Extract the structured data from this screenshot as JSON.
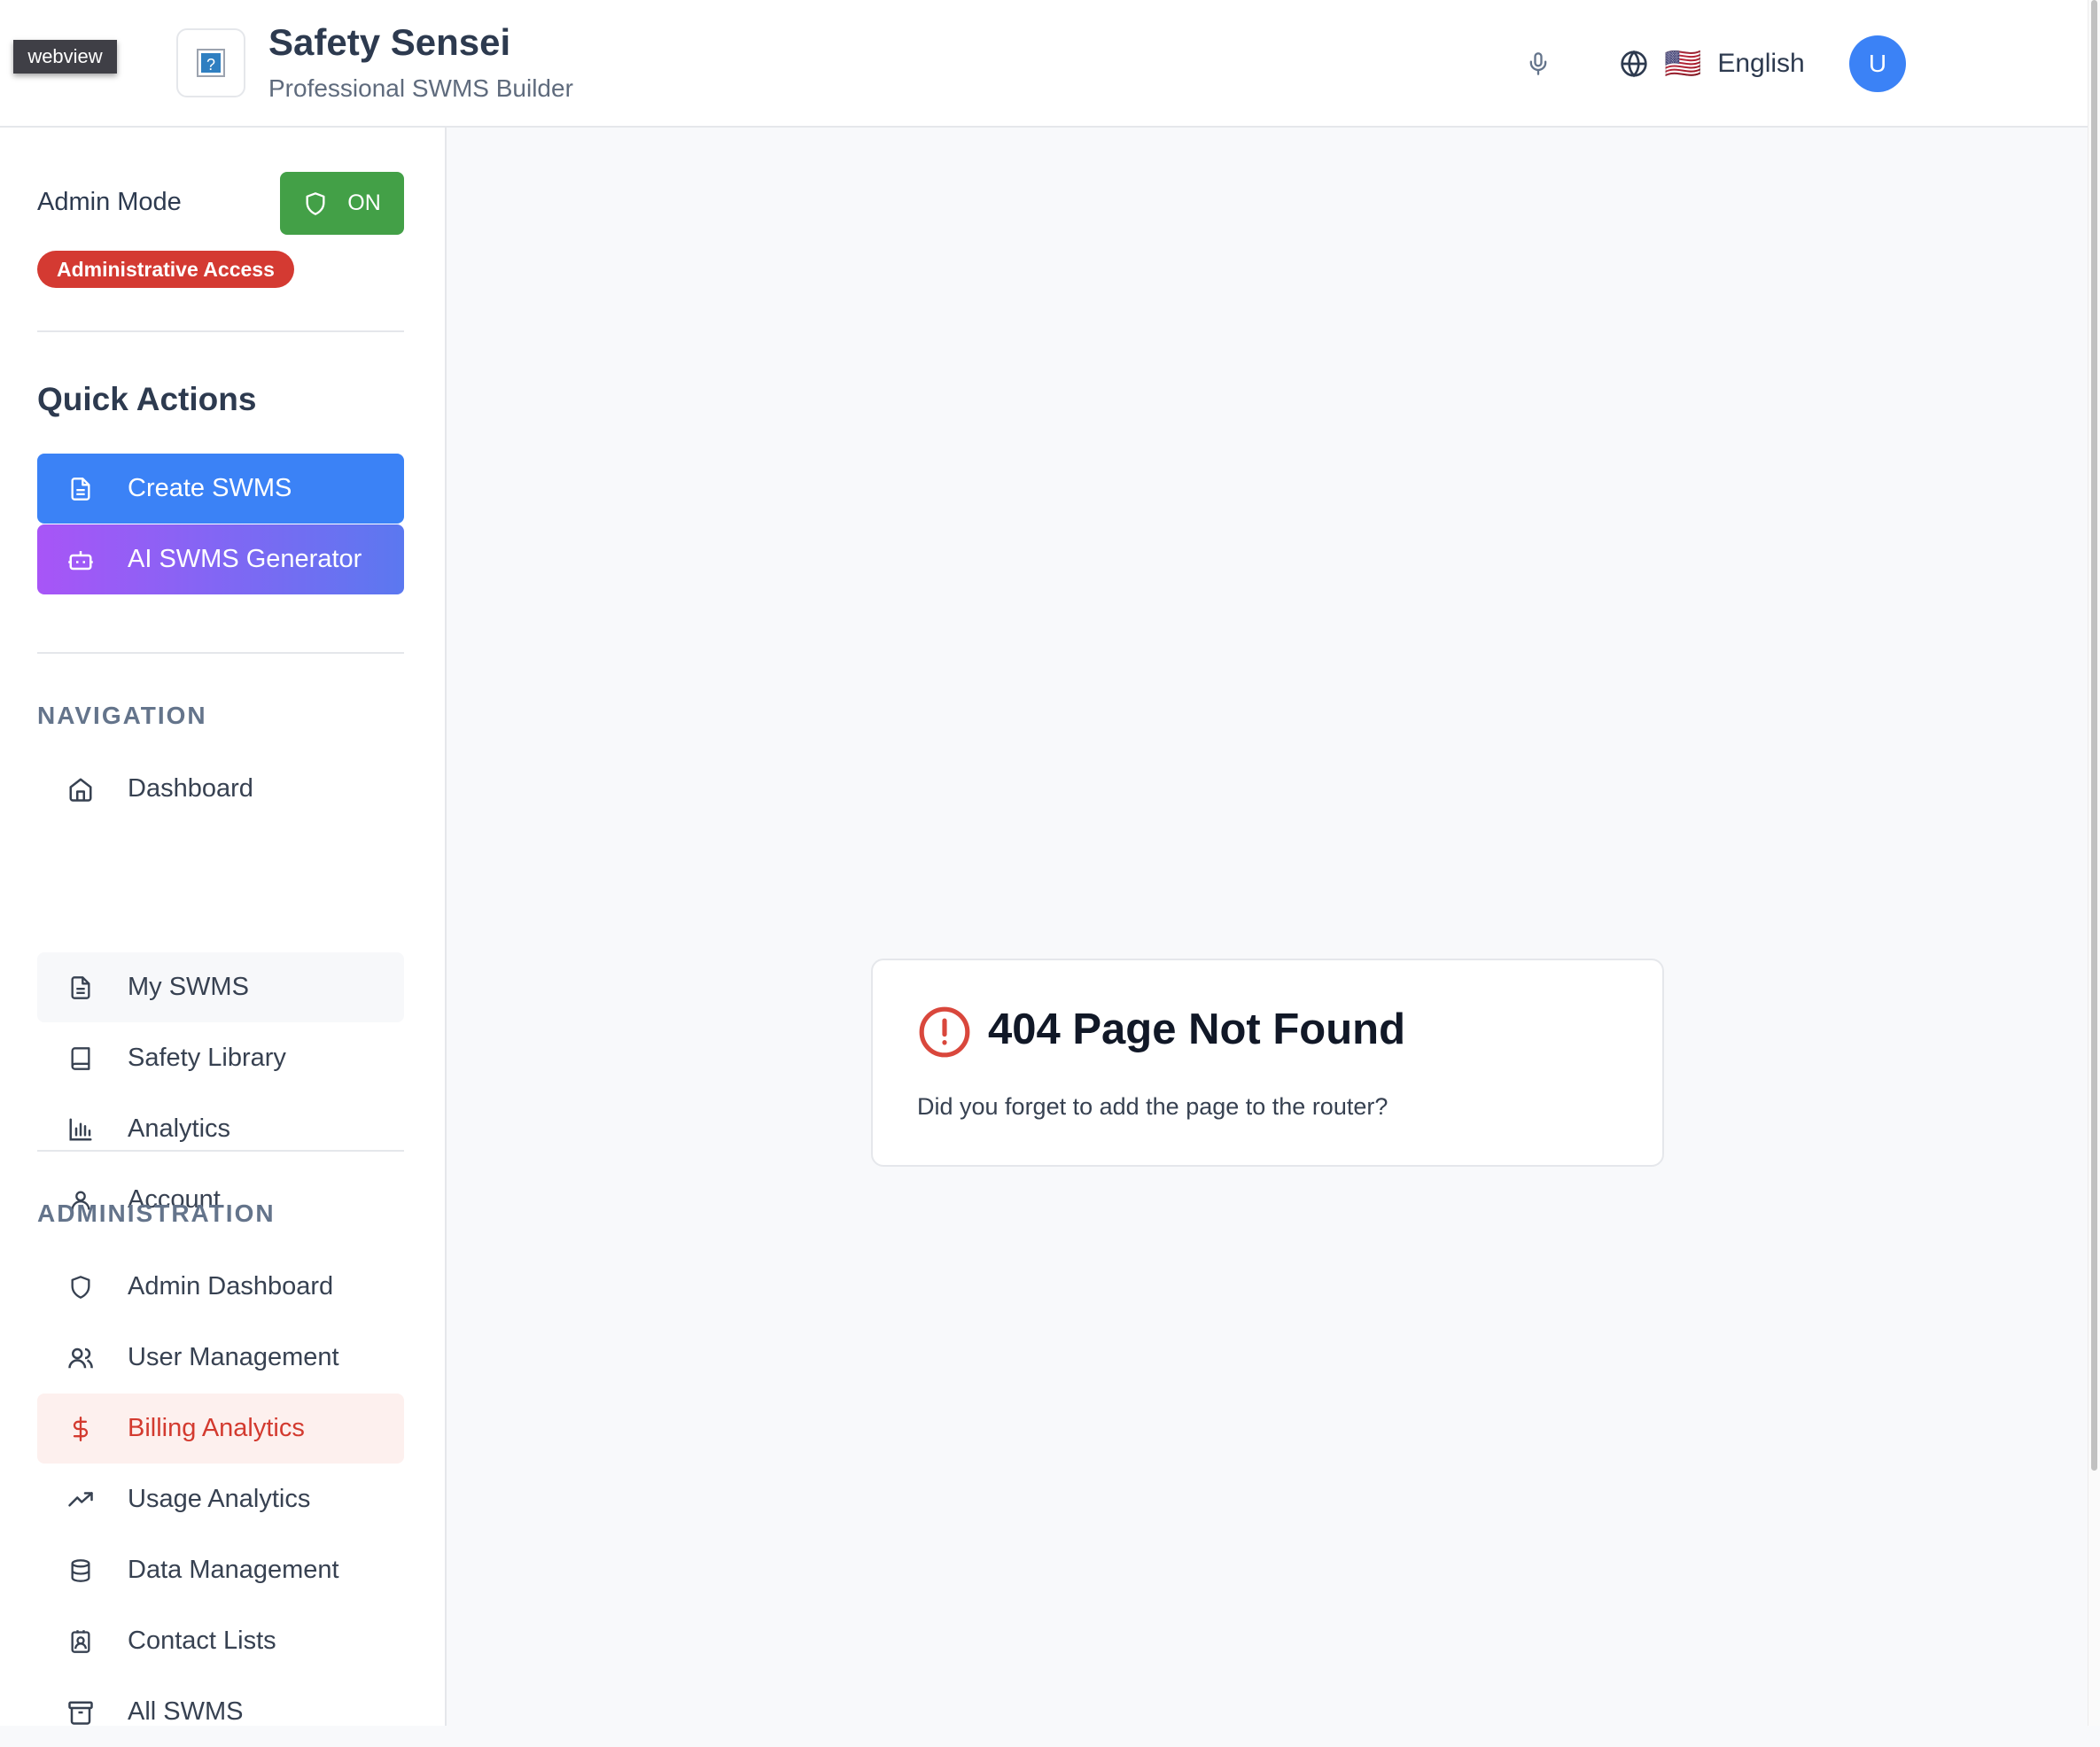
{
  "webview_tag": "webview",
  "app": {
    "title": "Safety Sensei",
    "subtitle": "Professional SWMS Builder",
    "logo_icon": "broken-image-icon"
  },
  "header": {
    "mic_icon": "microphone-icon",
    "language_icon": "globe-icon",
    "language_flag": "🇺🇸",
    "language_label": "English",
    "avatar_initial": "U"
  },
  "sidebar": {
    "admin_mode_label": "Admin Mode",
    "admin_toggle_label": "ON",
    "admin_badge": "Administrative Access",
    "quick_actions_title": "Quick Actions",
    "quick_actions": [
      {
        "label": "Create SWMS",
        "icon": "file-text-icon"
      },
      {
        "label": "AI SWMS Generator",
        "icon": "bot-icon"
      }
    ],
    "navigation_title": "NAVIGATION",
    "navigation": [
      {
        "label": "Dashboard",
        "icon": "home-icon"
      },
      {
        "label": "My SWMS",
        "icon": "file-text-icon"
      },
      {
        "label": "Safety Library",
        "icon": "book-icon"
      },
      {
        "label": "Analytics",
        "icon": "bar-chart-icon"
      },
      {
        "label": "Account",
        "icon": "user-icon"
      }
    ],
    "administration_title": "ADMINISTRATION",
    "administration": [
      {
        "label": "Admin Dashboard",
        "icon": "shield-icon"
      },
      {
        "label": "User Management",
        "icon": "users-icon"
      },
      {
        "label": "Billing Analytics",
        "icon": "dollar-icon",
        "active": true
      },
      {
        "label": "Usage Analytics",
        "icon": "trending-up-icon"
      },
      {
        "label": "Data Management",
        "icon": "database-icon"
      },
      {
        "label": "Contact Lists",
        "icon": "contact-icon"
      },
      {
        "label": "All SWMS",
        "icon": "archive-icon"
      }
    ]
  },
  "main": {
    "error_title": "404 Page Not Found",
    "error_message": "Did you forget to add the page to the router?",
    "error_icon": "alert-circle-icon"
  },
  "colors": {
    "primary": "#3b82f6",
    "admin_on": "#43a047",
    "danger": "#d43a32",
    "ai_gradient_start": "#a855f7",
    "ai_gradient_end": "#5b78f0",
    "active_bg": "#fdf0ee"
  }
}
